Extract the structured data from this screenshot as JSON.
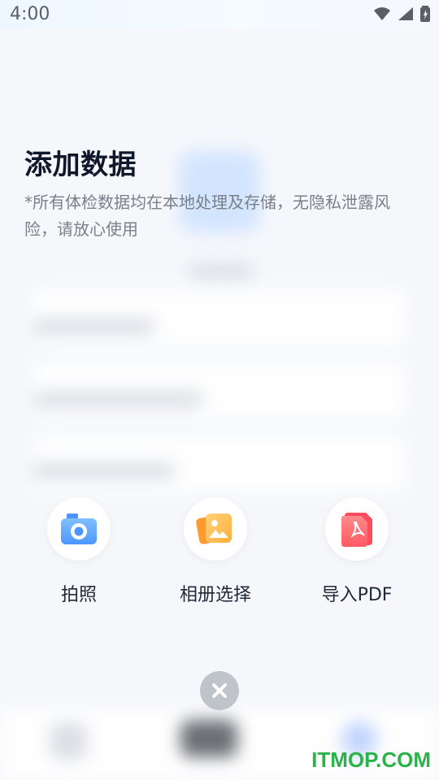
{
  "status_bar": {
    "time": "4:00",
    "icons": [
      "wifi-icon",
      "signal-icon",
      "battery-icon"
    ]
  },
  "sheet": {
    "title": "添加数据",
    "subtitle": "*所有体检数据均在本地处理及存储，无隐私泄露风险，请放心使用",
    "options": [
      {
        "label": "拍照",
        "icon": "camera-icon",
        "color": "#5aa7ff"
      },
      {
        "label": "相册选择",
        "icon": "album-icon",
        "color": "#ffb047"
      },
      {
        "label": "导入PDF",
        "icon": "pdf-icon",
        "color": "#ff6b6b"
      }
    ],
    "close_icon": "close-icon"
  },
  "watermark": "ITMOP.COM"
}
